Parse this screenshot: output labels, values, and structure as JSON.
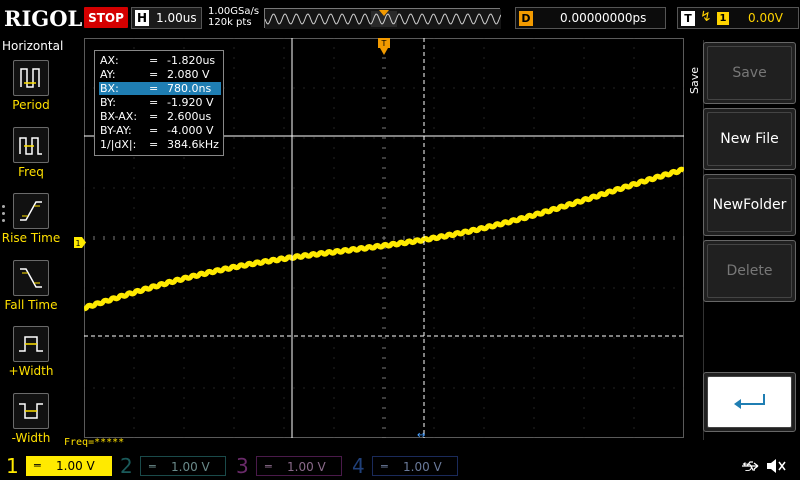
{
  "top": {
    "logo": "RIGOL",
    "run_state": "STOP",
    "horizontal_label": "H",
    "timebase": "1.00us",
    "sample_rate": "1.00GSa/s",
    "memory_depth": "120k pts",
    "delay_label": "D",
    "delay_value": "0.00000000ps",
    "trigger_label": "T",
    "trigger_edge_icon": "rising-edge-icon",
    "trigger_source": "1",
    "trigger_level": "0.00V"
  },
  "left_panel": {
    "title": "Horizontal",
    "items": [
      {
        "label": "Period",
        "icon": "period-icon"
      },
      {
        "label": "Freq",
        "icon": "frequency-icon"
      },
      {
        "label": "Rise Time",
        "icon": "rise-time-icon"
      },
      {
        "label": "Fall Time",
        "icon": "fall-time-icon"
      },
      {
        "label": "+Width",
        "icon": "positive-width-icon"
      },
      {
        "label": "-Width",
        "icon": "negative-width-icon"
      }
    ]
  },
  "cursor_readout": {
    "rows": [
      {
        "key": "AX:",
        "value": "-1.820us",
        "highlighted": false
      },
      {
        "key": "AY:",
        "value": "2.080 V",
        "highlighted": false
      },
      {
        "key": "BX:",
        "value": "780.0ns",
        "highlighted": true
      },
      {
        "key": "BY:",
        "value": "-1.920 V",
        "highlighted": false
      },
      {
        "key": "BX-AX:",
        "value": "2.600us",
        "highlighted": false
      },
      {
        "key": "BY-AY:",
        "value": "-4.000 V",
        "highlighted": false
      },
      {
        "key": "1/|dX|:",
        "value": "384.6kHz",
        "highlighted": false
      }
    ],
    "separator": "="
  },
  "measurement_line": "Freq=*****",
  "channel1_marker": "1",
  "waveform": {
    "color": "#ffea00",
    "trace": "rising-ramp"
  },
  "right_menu": {
    "title": "Save",
    "buttons": [
      {
        "label": "Save",
        "enabled": false
      },
      {
        "label": "New File",
        "enabled": true
      },
      {
        "label": "NewFolder",
        "enabled": true
      },
      {
        "label": "Delete",
        "enabled": false
      }
    ],
    "return_icon": "return-arrow-icon"
  },
  "channels": [
    {
      "num": "1",
      "coupling_icon": "dc-coupling-icon",
      "scale": "1.00 V",
      "active": true,
      "color": "#ffea00"
    },
    {
      "num": "2",
      "coupling_icon": "dc-coupling-icon",
      "scale": "1.00 V",
      "active": false,
      "color": "#00c0c0"
    },
    {
      "num": "3",
      "coupling_icon": "dc-coupling-icon",
      "scale": "1.00 V",
      "active": false,
      "color": "#c040c0"
    },
    {
      "num": "4",
      "coupling_icon": "dc-coupling-icon",
      "scale": "1.00 V",
      "active": false,
      "color": "#3a6fd0"
    }
  ],
  "status_icons": [
    "usb-icon",
    "speaker-muted-icon"
  ]
}
